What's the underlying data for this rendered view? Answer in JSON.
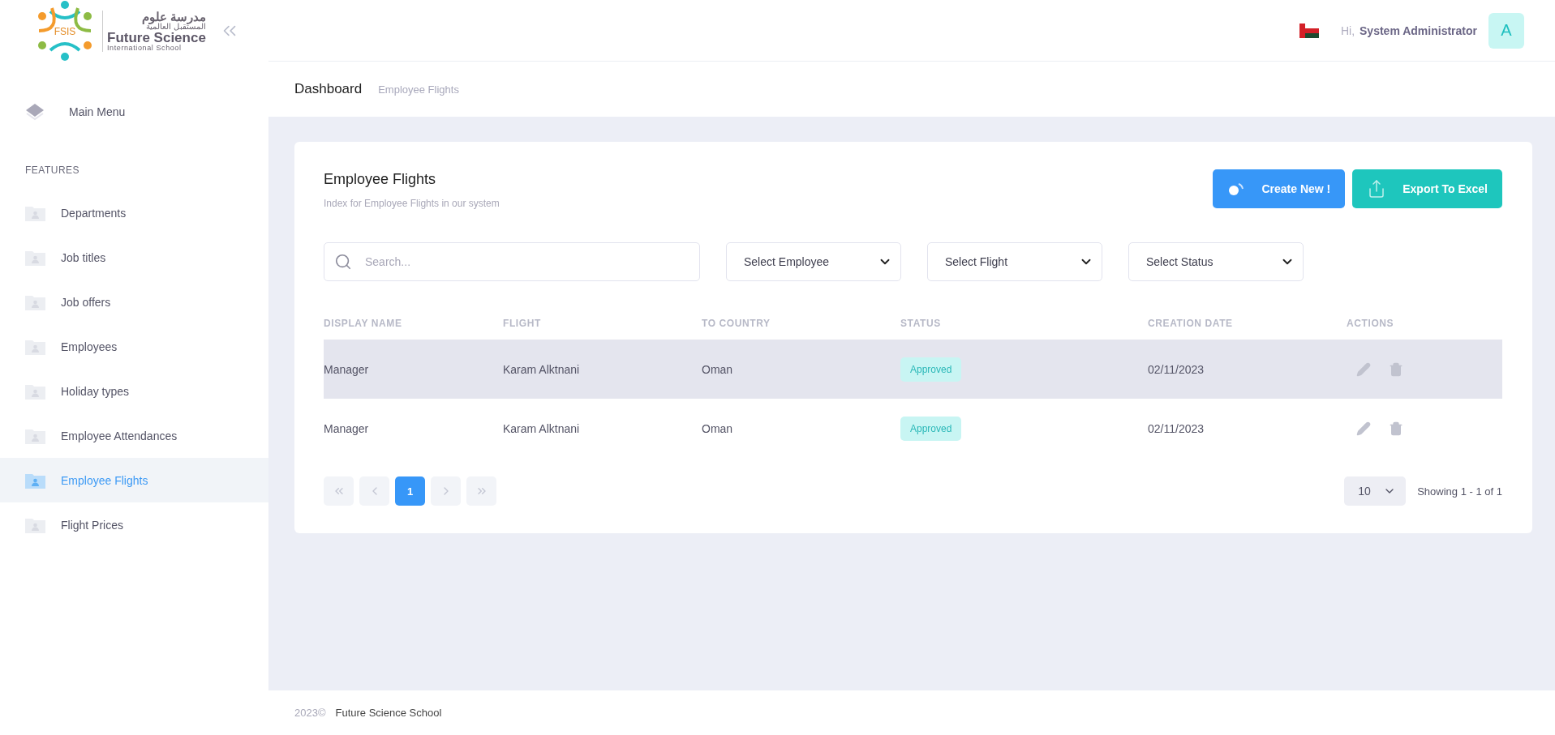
{
  "logo": {
    "badge": "FSIS",
    "arabic_title": "مدرسة علوم",
    "arabic_subtitle": "المستقبل العالمية",
    "name": "Future Science",
    "tagline": "International School"
  },
  "header": {
    "greeting": "Hi,",
    "user": "System Administrator",
    "avatar": "A"
  },
  "breadcrumb": {
    "title": "Dashboard",
    "current": "Employee Flights"
  },
  "sidebar": {
    "main_menu": "Main Menu",
    "section": "FEATURES",
    "items": [
      {
        "label": "Departments",
        "selected": false
      },
      {
        "label": "Job titles",
        "selected": false
      },
      {
        "label": "Job offers",
        "selected": false
      },
      {
        "label": "Employees",
        "selected": false
      },
      {
        "label": "Holiday types",
        "selected": false
      },
      {
        "label": "Employee Attendances",
        "selected": false
      },
      {
        "label": "Employee Flights",
        "selected": true
      },
      {
        "label": "Flight Prices",
        "selected": false
      }
    ]
  },
  "card": {
    "title": "Employee Flights",
    "subtitle": "Index for Employee Flights in our system",
    "buttons": [
      {
        "kind": "create",
        "label": "Create New !"
      },
      {
        "kind": "export",
        "label": "Export To Excel"
      }
    ],
    "search": {
      "placeholder": "Search..."
    },
    "filters": [
      "Select Employee",
      "Select Flight",
      "Select Status"
    ]
  },
  "table": {
    "columns": [
      "DISPLAY NAME",
      "FLIGHT",
      "TO COUNTRY",
      "STATUS",
      "CREATION DATE",
      "ACTIONS"
    ],
    "rows": [
      {
        "selected": true,
        "cells": [
          "Manager",
          "Karam Alktnani",
          "Oman",
          "Approved",
          "02/11/2023"
        ]
      },
      {
        "selected": false,
        "cells": [
          "Manager",
          "Karam Alktnani",
          "Oman",
          "Approved",
          "02/11/2023"
        ]
      }
    ]
  },
  "pagination": {
    "pages": [
      {
        "label": "1",
        "selected": true
      }
    ],
    "page_size": "10",
    "summary": "Showing 1 - 1 of 1"
  },
  "footer": {
    "year": "2023©",
    "name": "Future Science School"
  }
}
